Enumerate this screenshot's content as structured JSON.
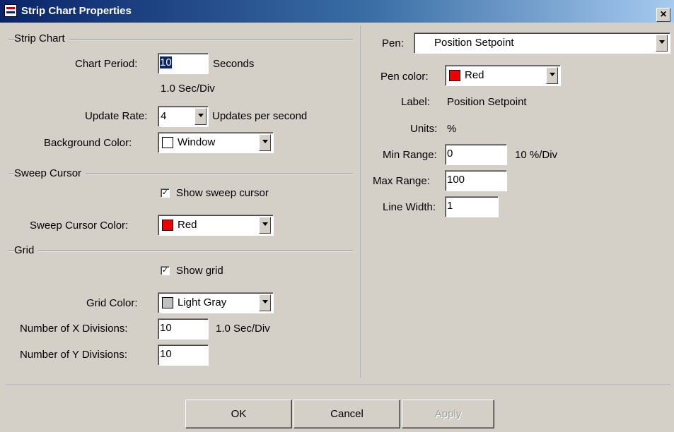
{
  "window": {
    "title": "Strip Chart Properties",
    "close_glyph": "×"
  },
  "strip_chart": {
    "section": "Strip Chart",
    "chart_period_label": "Chart Period:",
    "chart_period_value": "10",
    "chart_period_unit": "Seconds",
    "sec_per_div": "1.0 Sec/Div",
    "update_rate_label": "Update Rate:",
    "update_rate_value": "4",
    "update_rate_unit": "Updates per second",
    "background_color_label": "Background Color:",
    "background_color_value": "Window",
    "background_color_swatch": "#ffffff"
  },
  "sweep_cursor": {
    "section": "Sweep Cursor",
    "show_label": "Show sweep cursor",
    "show_checked": true,
    "color_label": "Sweep Cursor Color:",
    "color_value": "Red",
    "color_swatch": "#ee0000"
  },
  "grid": {
    "section": "Grid",
    "show_label": "Show grid",
    "show_checked": true,
    "color_label": "Grid Color:",
    "color_value": "Light Gray",
    "color_swatch": "#c0c0c0",
    "x_div_label": "Number of X Divisions:",
    "x_div_value": "10",
    "x_div_unit": "1.0 Sec/Div",
    "y_div_label": "Number of Y Divisions:",
    "y_div_value": "10"
  },
  "pen": {
    "label": "Pen:",
    "value": "Position Setpoint",
    "color_label": "Pen color:",
    "color_value": "Red",
    "color_swatch": "#ee0000",
    "label_label": "Label:",
    "label_value": "Position Setpoint",
    "units_label": "Units:",
    "units_value": "%",
    "min_label": "Min Range:",
    "min_value": "0",
    "min_unit": "10 %/Div",
    "max_label": "Max Range:",
    "max_value": "100",
    "line_width_label": "Line Width:",
    "line_width_value": "1"
  },
  "buttons": {
    "ok": "OK",
    "cancel": "Cancel",
    "apply": "Apply"
  },
  "icons": {
    "checkmark": "check-icon",
    "dropdown": "chevron-down-icon",
    "close": "close-icon"
  }
}
